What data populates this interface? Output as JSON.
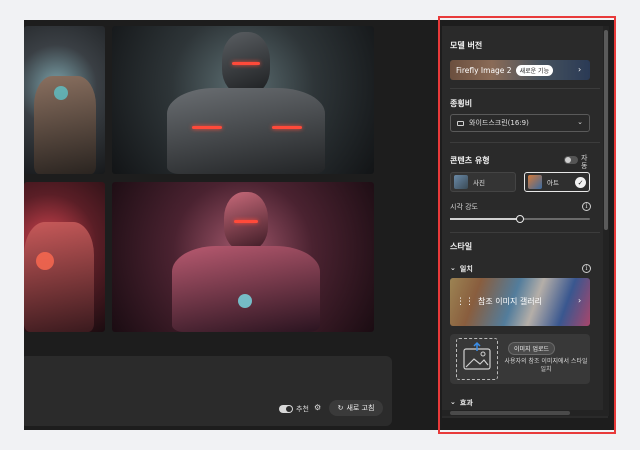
{
  "canvas": {
    "recommend_label": "추천",
    "refresh_label": "새로 고침"
  },
  "panel": {
    "model_version": {
      "title": "모델 버전",
      "model_name": "Firefly Image 2",
      "new_badge": "새로운 기능"
    },
    "aspect_ratio": {
      "title": "종횡비",
      "selected": "와이드스크린(16:9)"
    },
    "content_type": {
      "title": "콘텐츠 유형",
      "auto_label": "자동",
      "options": [
        {
          "label": "사진",
          "selected": false
        },
        {
          "label": "아트",
          "selected": true
        }
      ],
      "visual_intensity_label": "시각 강도",
      "visual_intensity_value": 0.5
    },
    "style": {
      "title": "스타일",
      "match_label": "일치",
      "gallery_label": "참조 이미지 갤러리",
      "upload_badge": "이미지 업로드",
      "upload_desc": "사용자의 참조 이미지에서 스타일 일치",
      "effects_label": "효과"
    }
  },
  "colors": {
    "highlight": "#e83a3a",
    "panel_bg": "#2a2a2a",
    "app_bg": "#1d1d1d"
  }
}
